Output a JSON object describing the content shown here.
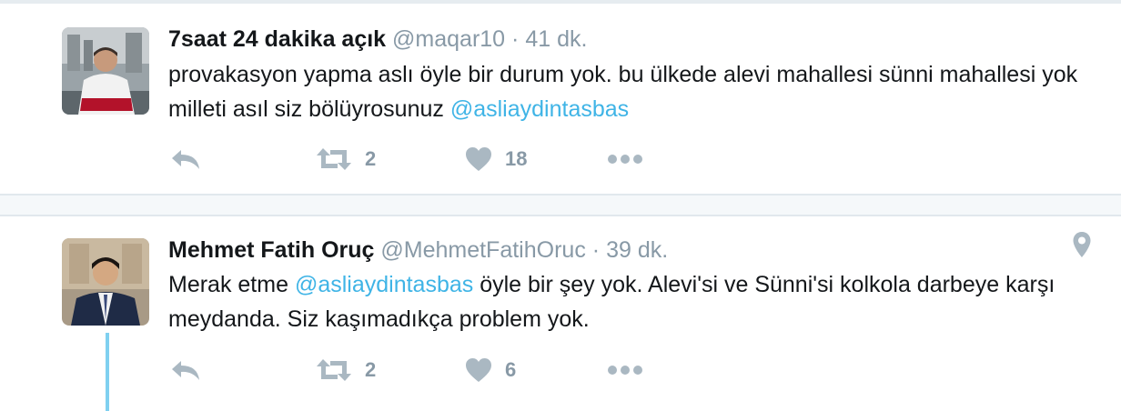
{
  "tweets": [
    {
      "fullname": "7saat 24 dakika açık",
      "username": "@maqar10",
      "separator": "·",
      "time": "41 dk.",
      "text_before": "provakasyon yapma aslı öyle bir durum yok. bu ülkede alevi mahallesi sünni mahallesi yok milleti asıl siz bölüyrosunuz ",
      "mention": "@asliaydintasbas",
      "text_after": "",
      "retweet_count": "2",
      "like_count": "18"
    },
    {
      "fullname": "Mehmet Fatih Oruç",
      "username": "@MehmetFatihOruc",
      "separator": "·",
      "time": "39 dk.",
      "text_before": "Merak etme ",
      "mention": "@asliaydintasbas",
      "text_after": " öyle bir şey yok. Alevi'si ve Sünni'si kolkola darbeye karşı meydanda. Siz kaşımadıkça problem yok.",
      "retweet_count": "2",
      "like_count": "6"
    }
  ],
  "colors": {
    "text": "#14171a",
    "muted": "#8899a6",
    "link": "#3fb4e6",
    "icon": "#aab8c2",
    "divider": "#e1e8ed",
    "thread_line": "#7fd0f0"
  },
  "icons": [
    "reply-icon",
    "retweet-icon",
    "heart-icon",
    "more-icon",
    "location-pin-icon"
  ]
}
